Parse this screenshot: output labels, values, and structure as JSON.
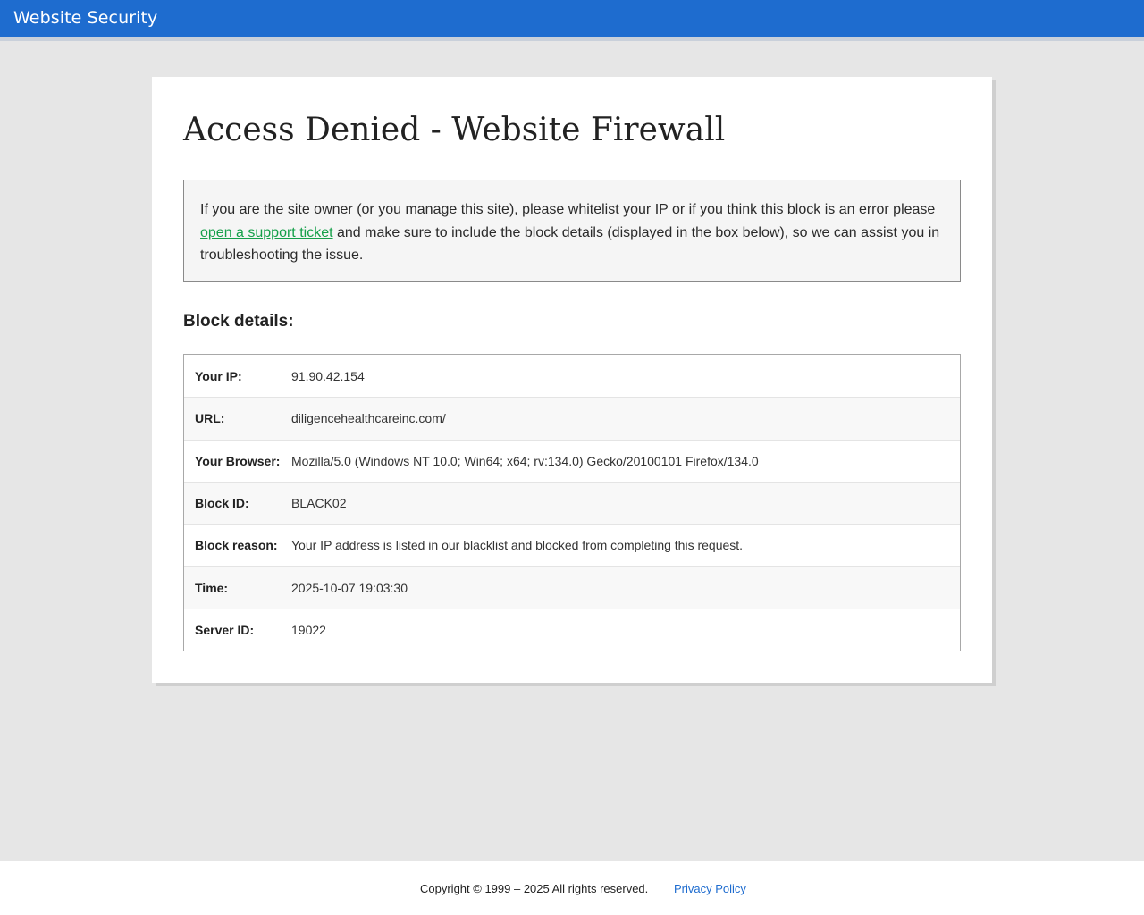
{
  "header": {
    "brand": "Website Security"
  },
  "page": {
    "title": "Access Denied - Website Firewall"
  },
  "notice": {
    "text_before": "If you are the site owner (or you manage this site), please whitelist your IP or if you think this block is an error please ",
    "link_label": "open a support ticket",
    "text_after": " and make sure to include the block details (displayed in the box below), so we can assist you in troubleshooting the issue."
  },
  "block_details": {
    "heading": "Block details:",
    "rows": [
      {
        "label": "Your IP:",
        "value": "91.90.42.154"
      },
      {
        "label": "URL:",
        "value": "diligencehealthcareinc.com/"
      },
      {
        "label": "Your Browser:",
        "value": "Mozilla/5.0 (Windows NT 10.0; Win64; x64; rv:134.0) Gecko/20100101 Firefox/134.0"
      },
      {
        "label": "Block ID:",
        "value": "BLACK02"
      },
      {
        "label": "Block reason:",
        "value": "Your IP address is listed in our blacklist and blocked from completing this request."
      },
      {
        "label": "Time:",
        "value": "2025-10-07 19:03:30"
      },
      {
        "label": "Server ID:",
        "value": "19022"
      }
    ]
  },
  "footer": {
    "copyright": "Copyright © 1999 – 2025 All rights reserved.",
    "privacy_label": "Privacy Policy"
  },
  "colors": {
    "header_bg": "#1e6ccf",
    "link_green": "#15a04a",
    "page_bg": "#e6e6e6"
  }
}
